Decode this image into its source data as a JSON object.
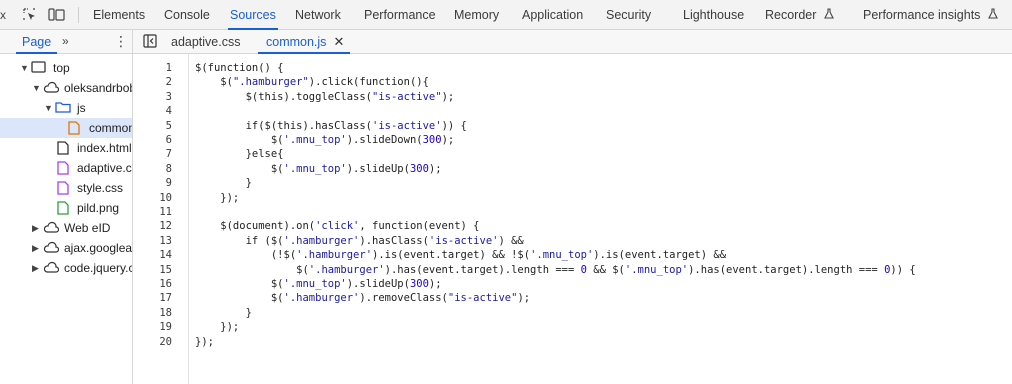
{
  "topbar": {
    "close_glyph": "x",
    "tabs": [
      {
        "label": "Elements",
        "active": false
      },
      {
        "label": "Console",
        "active": false
      },
      {
        "label": "Sources",
        "active": true
      },
      {
        "label": "Network",
        "active": false
      },
      {
        "label": "Performance",
        "active": false
      },
      {
        "label": "Memory",
        "active": false
      },
      {
        "label": "Application",
        "active": false
      },
      {
        "label": "Security",
        "active": false
      },
      {
        "label": "Lighthouse",
        "active": false
      },
      {
        "label": "Recorder",
        "active": false,
        "icon": "flask-icon"
      },
      {
        "label": "Performance insights",
        "active": false,
        "icon": "flask-icon"
      }
    ],
    "accent_color": "#1a5ed8"
  },
  "sidebar": {
    "page_tab": "Page",
    "more_glyph": "»",
    "menu_glyph": "⋮",
    "tree": [
      {
        "label": "top",
        "icon": "frame-icon",
        "expanded": true
      },
      {
        "label": "oleksandrbob",
        "icon": "cloud-icon",
        "expanded": true
      },
      {
        "label": "js",
        "icon": "folder-icon",
        "expanded": true
      },
      {
        "label": "common",
        "icon": "file-icon",
        "selected": true
      },
      {
        "label": "index.html",
        "icon": "file-icon"
      },
      {
        "label": "adaptive.css",
        "icon": "file-icon"
      },
      {
        "label": "style.css",
        "icon": "file-icon"
      },
      {
        "label": "pild.png",
        "icon": "file-icon"
      },
      {
        "label": "Web eID",
        "icon": "cloud-icon",
        "expanded": false
      },
      {
        "label": "ajax.googleapis",
        "icon": "cloud-icon",
        "expanded": false
      },
      {
        "label": "code.jquery.com",
        "icon": "cloud-icon",
        "expanded": false
      }
    ]
  },
  "filebar": {
    "tabs": [
      {
        "label": "adaptive.css",
        "active": false
      },
      {
        "label": "common.js",
        "active": true,
        "close_glyph": "✕"
      }
    ]
  },
  "editor": {
    "line_numbers": [
      "1",
      "2",
      "3",
      "4",
      "5",
      "6",
      "7",
      "8",
      "9",
      "10",
      "11",
      "12",
      "13",
      "14",
      "15",
      "16",
      "17",
      "18",
      "19",
      "20"
    ],
    "lines": [
      "$(function() {",
      "    $(\".hamburger\").click(function(){",
      "        $(this).toggleClass(\"is-active\");",
      "",
      "        if($(this).hasClass('is-active')) {",
      "            $('.mnu_top').slideDown(300);",
      "        }else{",
      "            $('.mnu_top').slideUp(300);",
      "        }",
      "    });",
      "",
      "    $(document).on('click', function(event) {",
      "        if ($('.hamburger').hasClass('is-active') &&",
      "            (!$('.hamburger').is(event.target) && !$('.mnu_top').is(event.target) &&",
      "                $('.hamburger').has(event.target).length === 0 && $('.mnu_top').has(event.target).length === 0)) {",
      "            $('.mnu_top').slideUp(300);",
      "            $('.hamburger').removeClass(\"is-active\");",
      "        }",
      "    });",
      "});"
    ]
  }
}
